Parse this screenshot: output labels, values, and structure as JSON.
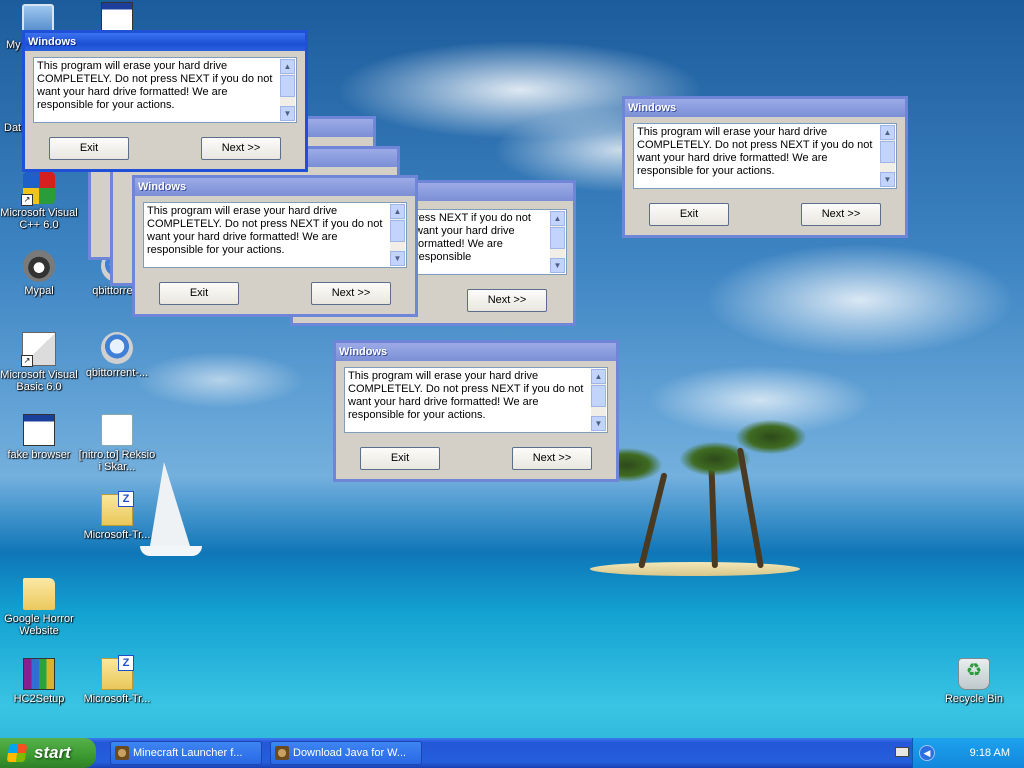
{
  "desktop": {
    "icons": [
      {
        "label": "My"
      },
      {
        "label": "Dat"
      },
      {
        "label": "Microsoft Visual C++ 6.0"
      },
      {
        "label": "Mypal"
      },
      {
        "label": "qbittorrent"
      },
      {
        "label": "Microsoft Visual Basic 6.0"
      },
      {
        "label": "qbittorrent-..."
      },
      {
        "label": "fake browser"
      },
      {
        "label": "[nitro.to] Reksio i Skar..."
      },
      {
        "label": "Microsoft-Tr..."
      },
      {
        "label": "Google Horror Website"
      },
      {
        "label": "HC2Setup"
      },
      {
        "label": "Microsoft-Tr..."
      },
      {
        "label": "Recycle Bin"
      }
    ]
  },
  "dialog": {
    "title": "Windows",
    "message": "This program will erase your hard drive COMPLETELY. Do not press NEXT if you do not want your hard drive formatted! We are responsible for your actions.",
    "message_truncated": "ress NEXT if you do not want your hard drive formatted! We are responsible",
    "exit_label": "Exit",
    "next_label": "Next >>"
  },
  "taskbar": {
    "start_label": "start",
    "tasks": [
      {
        "label": "Minecraft Launcher f..."
      },
      {
        "label": "Download Java for W..."
      }
    ],
    "clock": "9:18 AM"
  }
}
